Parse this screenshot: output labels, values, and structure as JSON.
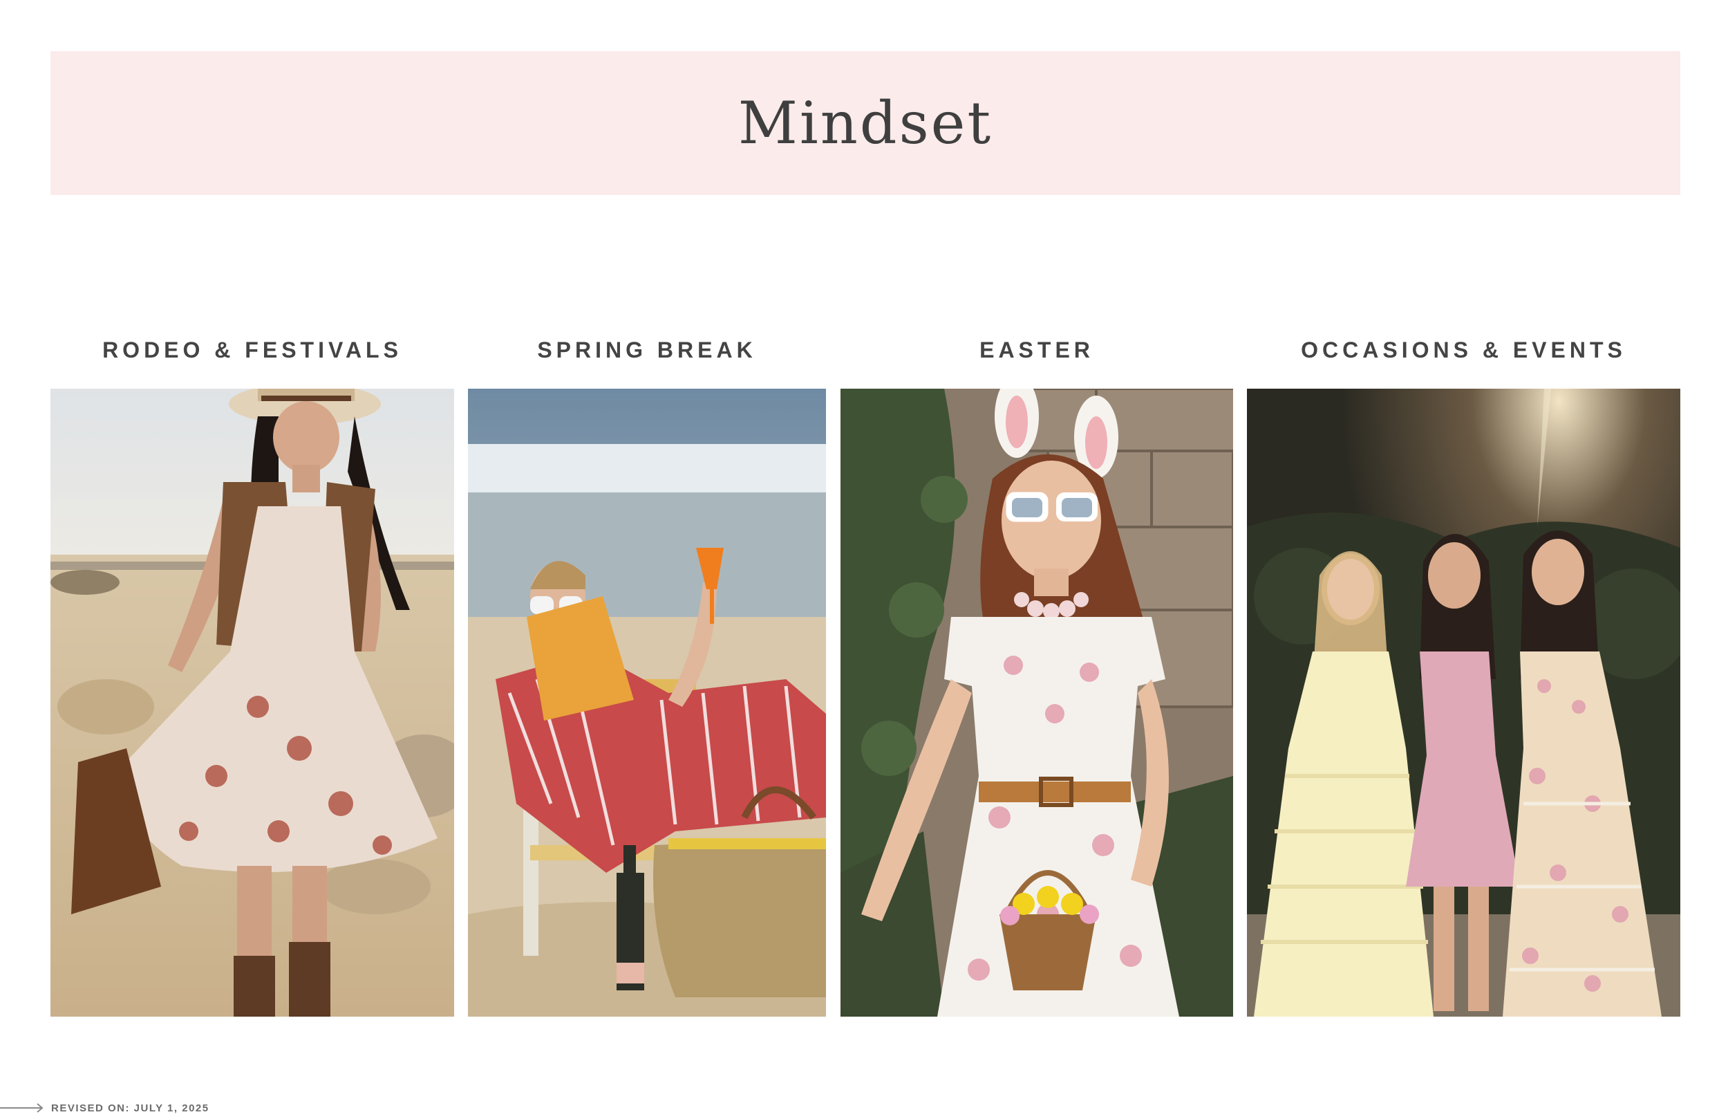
{
  "header": {
    "title": "Mindset"
  },
  "categories": [
    {
      "heading": "RODEO & FESTIVALS",
      "image": "rodeo-festival-outfit-photo"
    },
    {
      "heading": "SPRING BREAK",
      "image": "spring-break-beach-photo"
    },
    {
      "heading": "EASTER",
      "image": "easter-bunny-ears-photo"
    },
    {
      "heading": "OCCASIONS & EVENTS",
      "image": "occasions-events-dresses-photo"
    }
  ],
  "footer": {
    "revised": "REVISED ON: JULY 1, 2025",
    "arrow_icon": "arrow-right-icon"
  },
  "colors": {
    "banner_background": "#fcebeb",
    "title_text": "#3f3f3f",
    "heading_text": "#444444",
    "footer_text": "#6b6b6b"
  }
}
